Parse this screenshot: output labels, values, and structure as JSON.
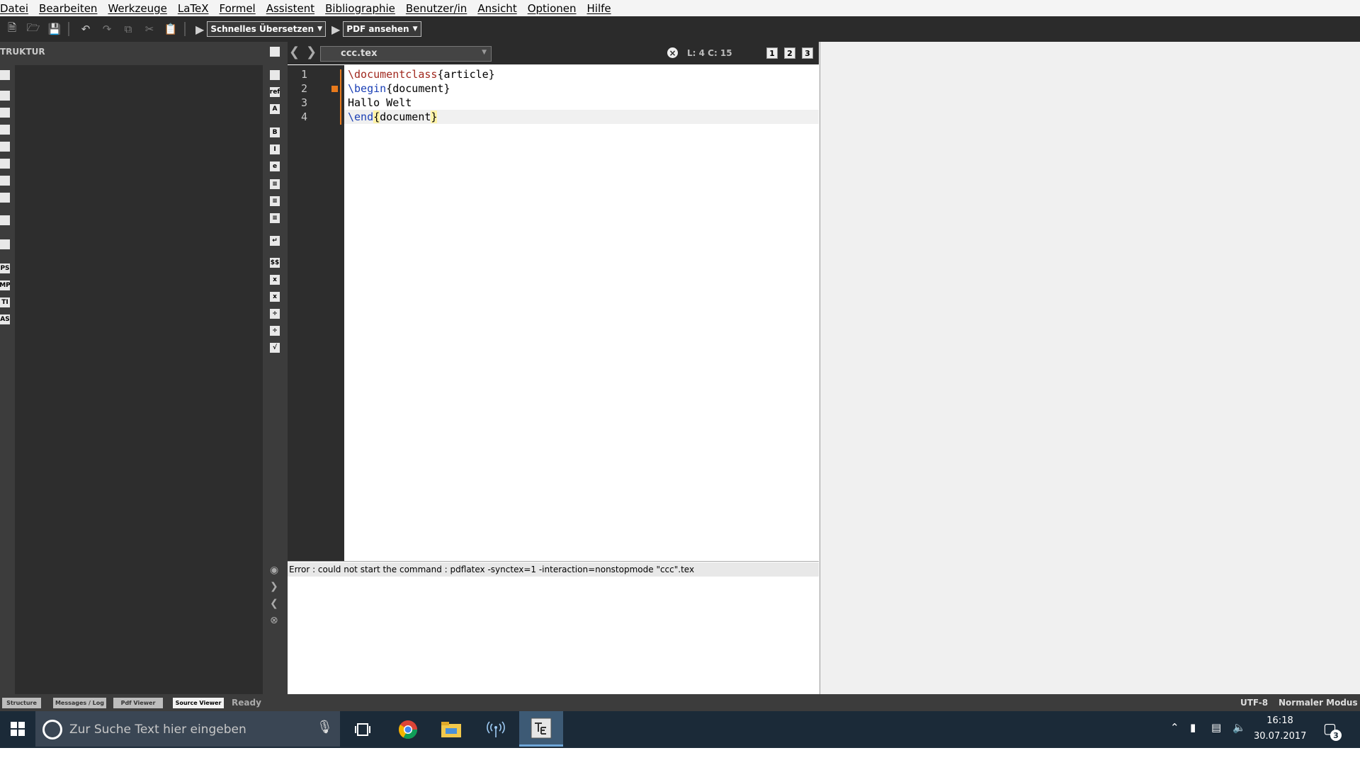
{
  "menu": [
    "Datei",
    "Bearbeiten",
    "Werkzeuge",
    "LaTeX",
    "Formel",
    "Assistent",
    "Bibliographie",
    "Benutzer/in",
    "Ansicht",
    "Optionen",
    "Hilfe"
  ],
  "toolbar": {
    "compile_combo": "Schnelles Übersetzen",
    "view_combo": "PDF ansehen"
  },
  "structure": {
    "header": "TRUKTUR"
  },
  "left_icons": [
    "",
    "",
    "",
    "",
    "",
    "",
    "",
    "",
    "",
    "",
    "PS",
    "MP",
    "TI",
    "AS"
  ],
  "mid_icons": [
    "",
    "ref",
    "A",
    "B",
    "I",
    "e",
    "",
    "",
    "",
    "",
    "$$",
    "",
    "",
    "",
    "",
    ""
  ],
  "editor": {
    "file_tab": "ccc.tex",
    "position": "L: 4 C: 15",
    "view_buttons": [
      "1",
      "2",
      "3"
    ],
    "line_numbers": [
      "1",
      "2",
      "3",
      "4"
    ],
    "lines": [
      {
        "cmd": "\\documentclass",
        "arg": "{article}"
      },
      {
        "cmd": "\\begin",
        "arg": "{document}"
      },
      {
        "text": "Hallo Welt"
      },
      {
        "cmd": "\\end",
        "open": "{",
        "arg": "document",
        "close": "}"
      }
    ]
  },
  "messages": {
    "line": "Error : could not start the command : pdflatex -synctex=1 -interaction=nonstopmode \"ccc\".tex"
  },
  "statusbar": {
    "tabs": [
      "Structure",
      "Messages / Log",
      "Pdf Viewer",
      "Source Viewer"
    ],
    "active_tab": "Source Viewer",
    "ready": "Ready",
    "encoding": "UTF-8",
    "mode": "Normaler Modus"
  },
  "taskbar": {
    "search_placeholder": "Zur Suche Text hier eingeben",
    "time": "16:18",
    "date": "30.07.2017",
    "notification_count": "3"
  },
  "colors": {
    "toolbar_bg": "#2b2b2b",
    "panel_bg": "#3c3c3c",
    "taskbar_bg": "#1b2a38",
    "accent_orange": "#e87a1c"
  }
}
